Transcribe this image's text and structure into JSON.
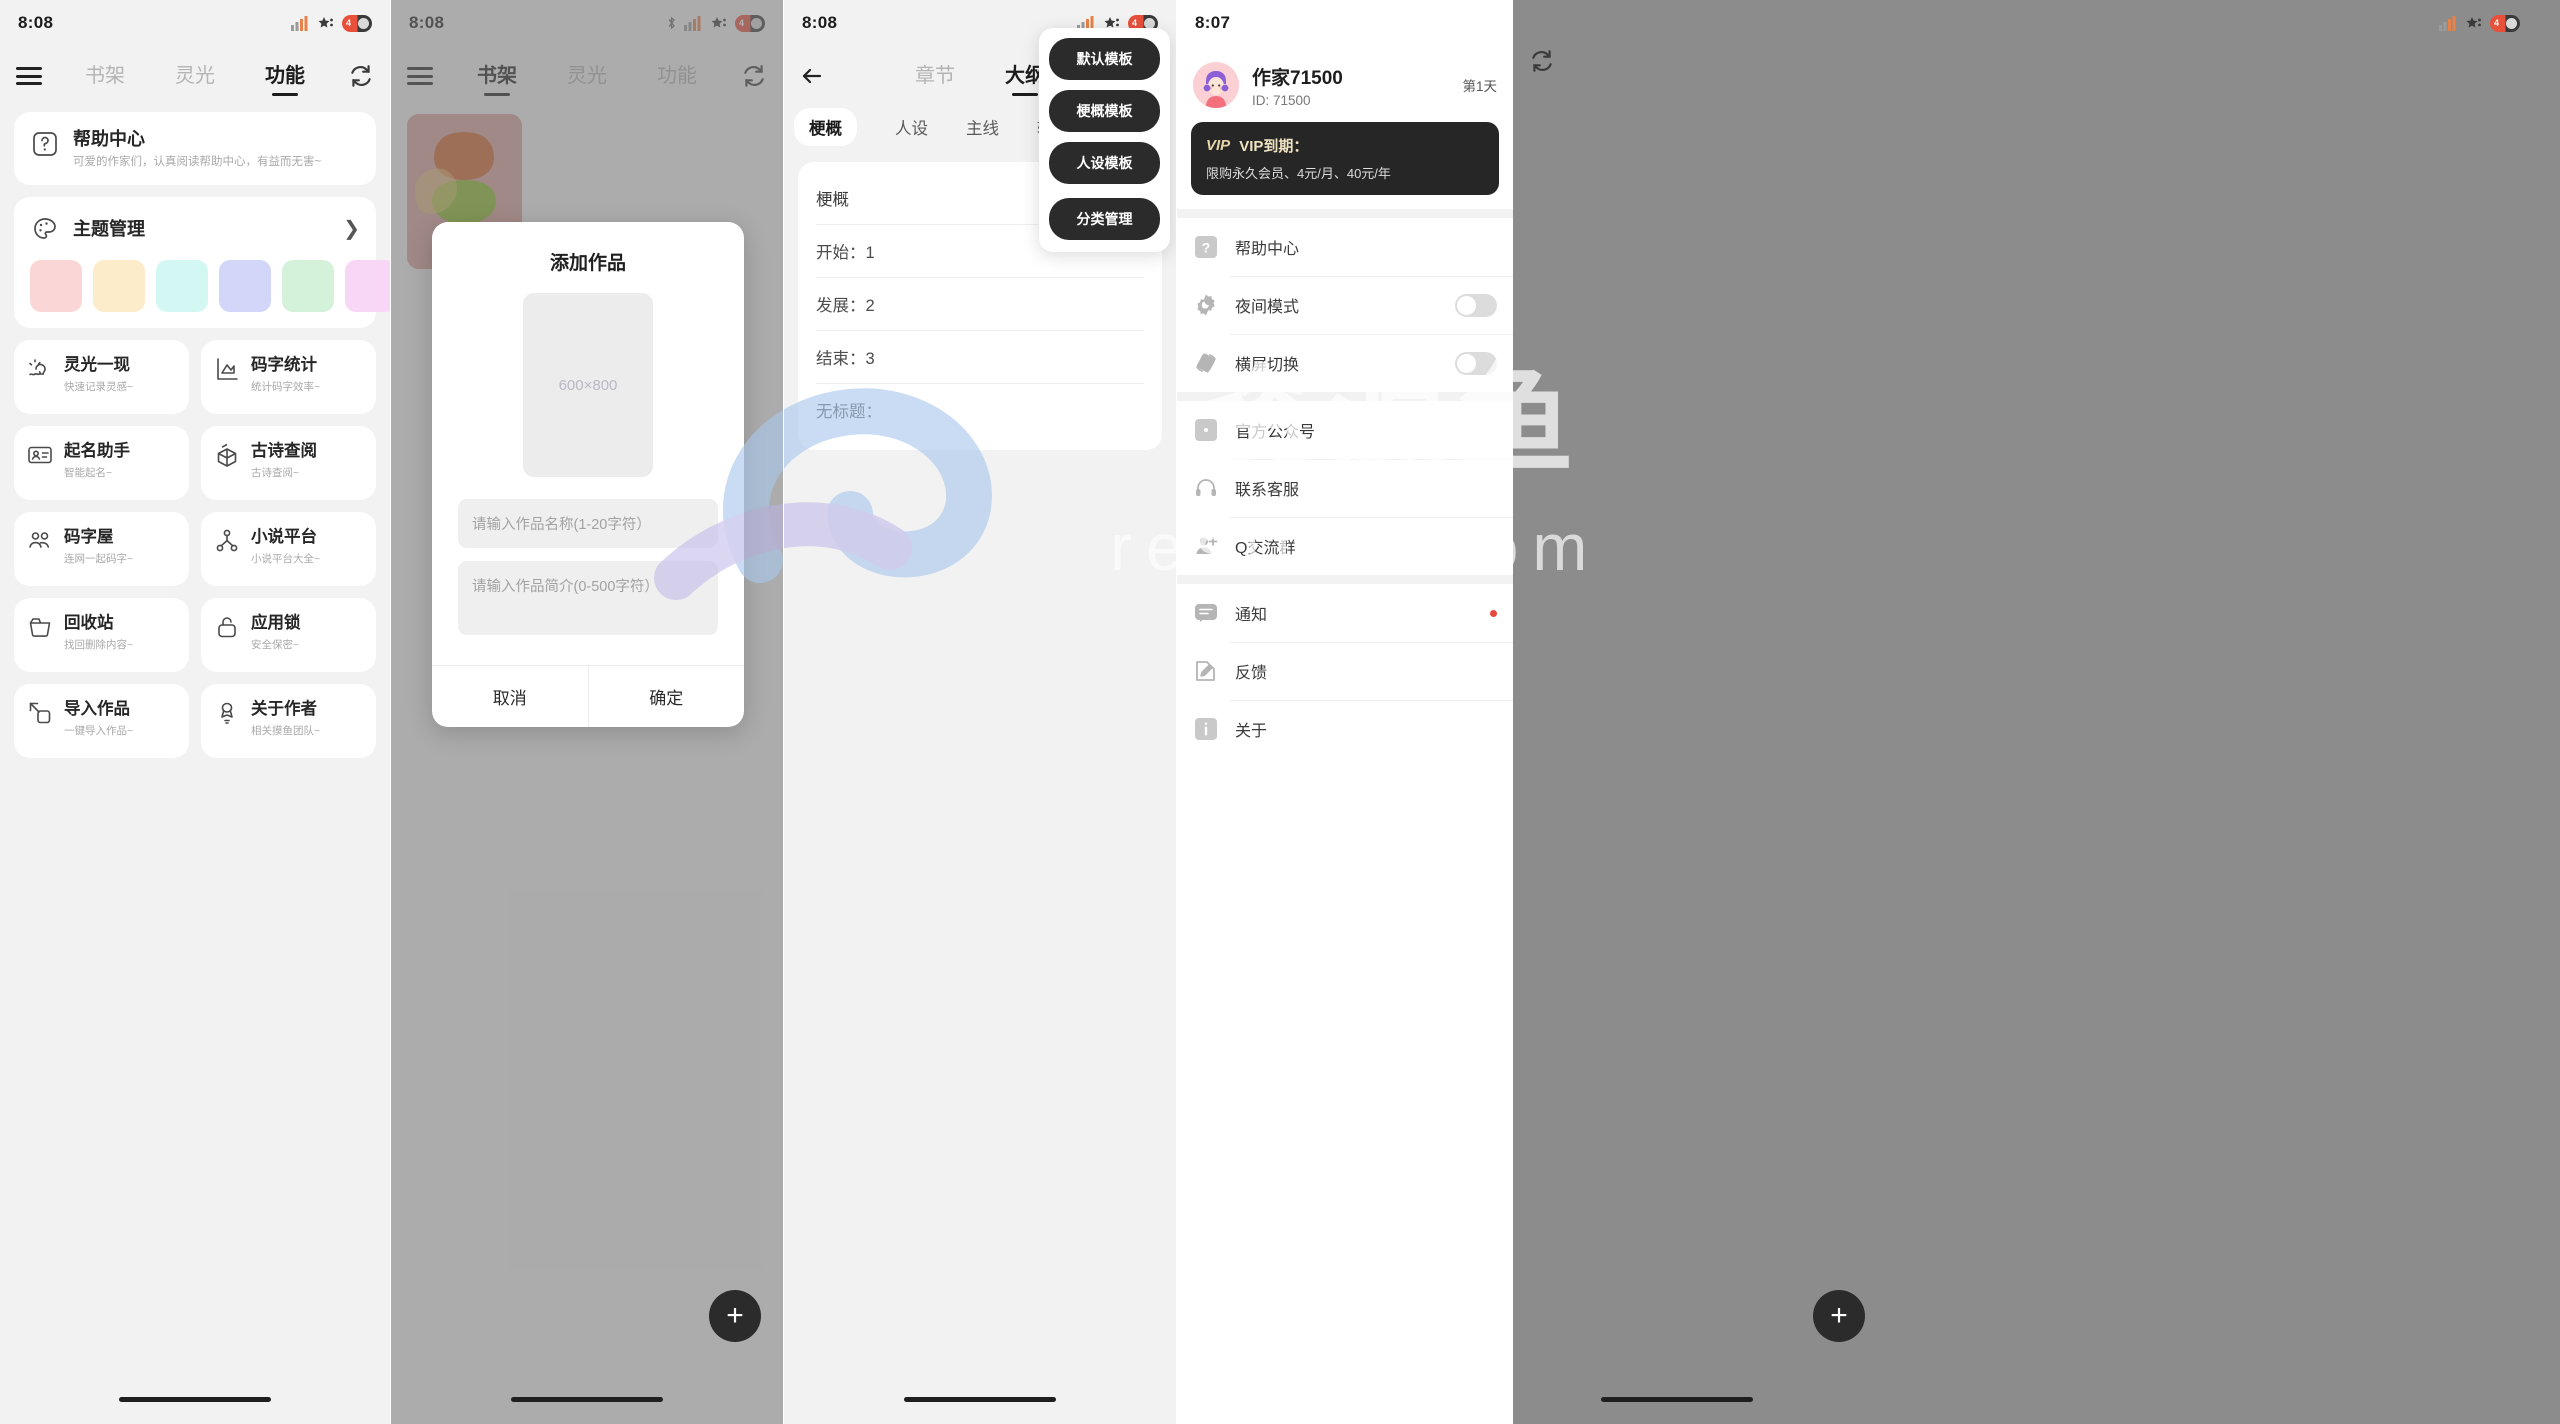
{
  "panels": [
    {
      "status": {
        "time": "8:08",
        "battery": "4"
      },
      "nav": {
        "menu_icon": "hamburger-icon",
        "refresh_icon": "refresh-icon",
        "tabs": [
          {
            "label": "书架",
            "active": false
          },
          {
            "label": "灵光",
            "active": false
          },
          {
            "label": "功能",
            "active": true
          }
        ]
      },
      "help_card": {
        "icon": "question-box-icon",
        "title": "帮助中心",
        "subtitle": "可爱的作家们，认真阅读帮助中心，有益而无害~"
      },
      "theme_card": {
        "icon": "palette-icon",
        "title": "主题管理",
        "chevron": "chevron-right-icon",
        "swatches": [
          "#fbd6d6",
          "#fdecc9",
          "#d3f7f2",
          "#d2d6f8",
          "#d4f2d9",
          "#f8d7f6"
        ]
      },
      "features": [
        {
          "icon": "lightbulb-idea-icon",
          "title": "灵光一现",
          "subtitle": "快速记录灵感~"
        },
        {
          "icon": "chart-stats-icon",
          "title": "码字统计",
          "subtitle": "统计码字效率~"
        },
        {
          "icon": "id-card-icon",
          "title": "起名助手",
          "subtitle": "智能起名~"
        },
        {
          "icon": "book-search-icon",
          "title": "古诗查阅",
          "subtitle": "古诗查阅~"
        },
        {
          "icon": "people-icon",
          "title": "码字屋",
          "subtitle": "连网一起码字~"
        },
        {
          "icon": "share-nodes-icon",
          "title": "小说平台",
          "subtitle": "小说平台大全~"
        },
        {
          "icon": "trash-icon",
          "title": "回收站",
          "subtitle": "找回删除内容~"
        },
        {
          "icon": "lock-icon",
          "title": "应用锁",
          "subtitle": "安全保密~"
        },
        {
          "icon": "import-icon",
          "title": "导入作品",
          "subtitle": "一键导入作品~"
        },
        {
          "icon": "author-badge-icon",
          "title": "关于作者",
          "subtitle": "相关摸鱼团队~"
        }
      ]
    },
    {
      "status": {
        "time": "8:08",
        "battery": "4"
      },
      "nav": {
        "menu_icon": "hamburger-icon",
        "refresh_icon": "refresh-icon",
        "tabs": [
          {
            "label": "书架",
            "active": true
          },
          {
            "label": "灵光",
            "active": false
          },
          {
            "label": "功能",
            "active": false
          }
        ]
      },
      "modal": {
        "title": "添加作品",
        "cover_placeholder": "600×800",
        "name_placeholder": "请输入作品名称(1-20字符）",
        "intro_placeholder": "请输入作品简介(0-500字符）",
        "cancel_label": "取消",
        "confirm_label": "确定"
      },
      "fab": "+"
    },
    {
      "status": {
        "time": "8:08",
        "battery": "4"
      },
      "nav": {
        "back_icon": "arrow-left-icon",
        "tabs": [
          {
            "label": "章节",
            "active": false
          },
          {
            "label": "大纲",
            "active": true
          }
        ]
      },
      "segments": [
        {
          "label": "梗概",
          "active": true
        },
        {
          "label": "人设",
          "active": false
        },
        {
          "label": "主线",
          "active": false
        },
        {
          "label": "辅线",
          "active": false
        }
      ],
      "outline_rows": [
        "梗概",
        "开始：1",
        "发展：2",
        "结束：3",
        "无标题："
      ],
      "dropdown": [
        "默认模板",
        "梗概模板",
        "人设模板",
        "分类管理"
      ]
    },
    {
      "status": {
        "time": "8:07",
        "battery": "4"
      },
      "refresh_icon": "refresh-icon",
      "profile": {
        "avatar": "user-avatar",
        "name": "作家71500",
        "id": "ID: 71500",
        "day": "第1天"
      },
      "vip": {
        "badge": "VIP",
        "title": "VIP到期：",
        "subtitle": "限购永久会员、4元/月、40元/年"
      },
      "settings_groups": [
        [
          {
            "icon": "question-box-icon",
            "label": "帮助中心",
            "control": "none"
          },
          {
            "icon": "gear-moon-icon",
            "label": "夜间模式",
            "control": "switch",
            "on": false
          },
          {
            "icon": "rotate-screen-icon",
            "label": "横屏切换",
            "control": "switch",
            "on": false
          }
        ],
        [
          {
            "icon": "wechat-official-icon",
            "label": "官方公众号",
            "control": "none"
          },
          {
            "icon": "headset-icon",
            "label": "联系客服",
            "control": "none"
          },
          {
            "icon": "user-plus-icon",
            "label": "Q交流群",
            "control": "none"
          }
        ],
        [
          {
            "icon": "message-icon",
            "label": "通知",
            "control": "dot"
          },
          {
            "icon": "feedback-pencil-icon",
            "label": "反馈",
            "control": "none"
          },
          {
            "icon": "info-icon",
            "label": "关于",
            "control": "none"
          }
        ]
      ],
      "fab": "+"
    }
  ],
  "watermark": {
    "title": "资源鱼",
    "subtitle": "resfish.com"
  }
}
